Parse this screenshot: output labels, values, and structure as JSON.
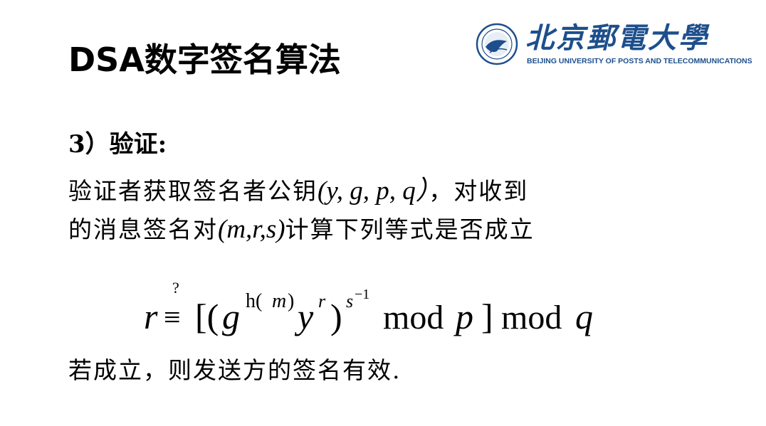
{
  "slide": {
    "title": "DSA数字签名算法",
    "logo": {
      "name_cn": "北京郵電大學",
      "name_en": "BEIJING UNIVERSITY OF POSTS AND TELECOMMUNICATIONS",
      "brand_color": "#1d4f8c",
      "seal_icon": "university-seal-icon"
    },
    "section_heading": "3）验证:",
    "para_line1": {
      "prefix": "验证者获取签名者公钥",
      "math": "(y,  g, p, q）",
      "suffix": "，对收到"
    },
    "para_line2": {
      "prefix": "的消息签名对",
      "math": "(m,r,s)",
      "suffix": "计算下列等式是否成立"
    },
    "formula": {
      "question_mark": "?",
      "lhs": "r",
      "equiv": "≡",
      "open": "[(",
      "g": "g",
      "g_exp_func": "h(",
      "g_exp_var": "m",
      "g_exp_close": ")",
      "y": "y",
      "y_exp": "r",
      "close_paren": ")",
      "s_base": "s",
      "s_exp": "−1",
      "mod1": "mod",
      "p": "p",
      "close_bracket": "]",
      "mod2": "mod",
      "q": "q"
    },
    "conclusion": "若成立，则发送方的签名有效."
  }
}
